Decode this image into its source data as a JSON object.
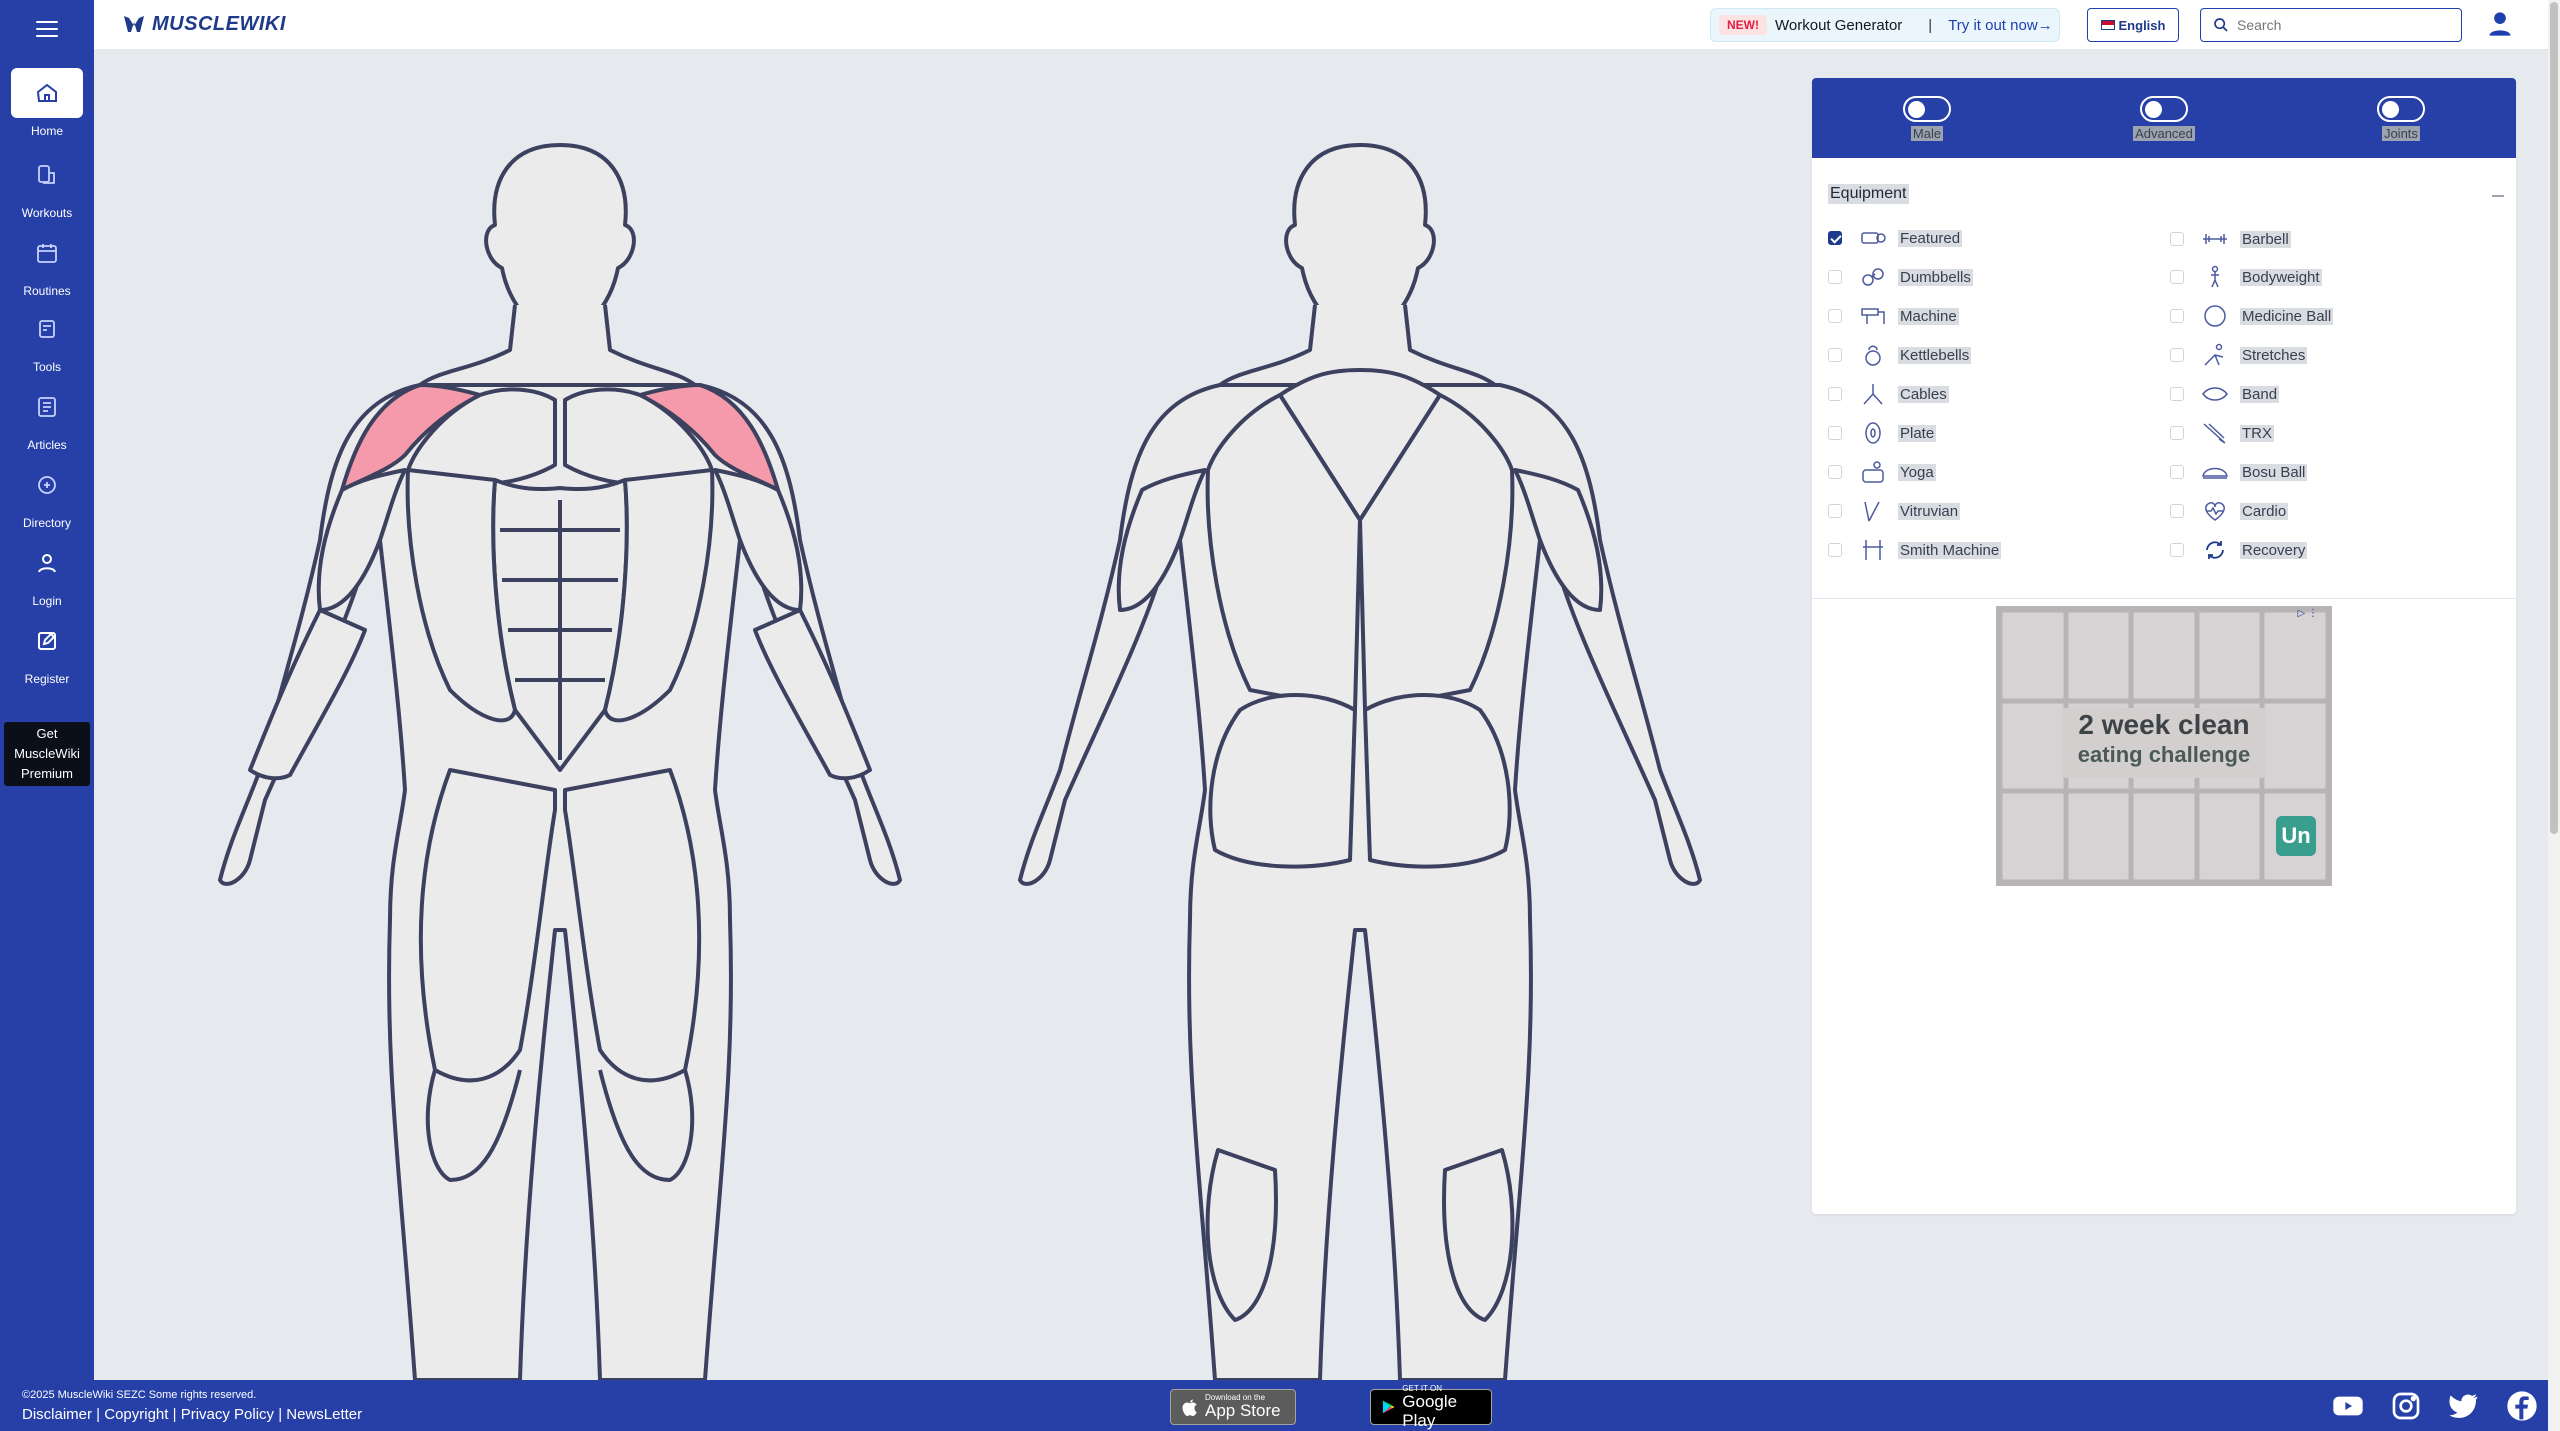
{
  "brand": {
    "logo_text": "MUSCLEWIKI"
  },
  "sidebar": {
    "items": [
      {
        "label": "Home",
        "icon": "home-icon",
        "active": true
      },
      {
        "label": "Workouts",
        "icon": "workouts-icon"
      },
      {
        "label": "Routines",
        "icon": "calendar-icon"
      },
      {
        "label": "Tools",
        "icon": "tools-icon"
      },
      {
        "label": "Articles",
        "icon": "articles-icon"
      },
      {
        "label": "Directory",
        "icon": "directory-icon"
      },
      {
        "label": "Login",
        "icon": "user-icon"
      },
      {
        "label": "Register",
        "icon": "edit-icon"
      }
    ],
    "premium": {
      "line1": "Get",
      "line2": "MuscleWiki",
      "line3": "Premium"
    }
  },
  "header": {
    "promo": {
      "badge": "NEW!",
      "title": "Workout Generator",
      "separator": "|",
      "cta": "Try it out now→"
    },
    "language": "English",
    "search_placeholder": "Search"
  },
  "body_map": {
    "highlight_color": "#f49aaa",
    "highlighted_muscle": "front-deltoids"
  },
  "filters": {
    "toggles": [
      {
        "label": "Male",
        "on": false
      },
      {
        "label": "Advanced",
        "on": false
      },
      {
        "label": "Joints",
        "on": false
      }
    ],
    "equipment_title": "Equipment",
    "equipment": [
      {
        "label": "Featured",
        "checked": true,
        "icon": "featured-icon"
      },
      {
        "label": "Barbell",
        "checked": false,
        "icon": "barbell-icon"
      },
      {
        "label": "Dumbbells",
        "checked": false,
        "icon": "dumbbell-icon"
      },
      {
        "label": "Bodyweight",
        "checked": false,
        "icon": "bodyweight-icon"
      },
      {
        "label": "Machine",
        "checked": false,
        "icon": "machine-icon"
      },
      {
        "label": "Medicine Ball",
        "checked": false,
        "icon": "medicine-ball-icon"
      },
      {
        "label": "Kettlebells",
        "checked": false,
        "icon": "kettlebell-icon"
      },
      {
        "label": "Stretches",
        "checked": false,
        "icon": "stretch-icon"
      },
      {
        "label": "Cables",
        "checked": false,
        "icon": "cable-icon"
      },
      {
        "label": "Band",
        "checked": false,
        "icon": "band-icon"
      },
      {
        "label": "Plate",
        "checked": false,
        "icon": "plate-icon"
      },
      {
        "label": "TRX",
        "checked": false,
        "icon": "trx-icon"
      },
      {
        "label": "Yoga",
        "checked": false,
        "icon": "yoga-icon"
      },
      {
        "label": "Bosu Ball",
        "checked": false,
        "icon": "bosu-ball-icon"
      },
      {
        "label": "Vitruvian",
        "checked": false,
        "icon": "vitruvian-icon"
      },
      {
        "label": "Cardio",
        "checked": false,
        "icon": "cardio-icon"
      },
      {
        "label": "Smith Machine",
        "checked": false,
        "icon": "smith-machine-icon"
      },
      {
        "label": "Recovery",
        "checked": false,
        "icon": "recovery-icon"
      }
    ]
  },
  "ad": {
    "line1": "2 week clean",
    "line2": "eating challenge",
    "logo": "Un"
  },
  "footer": {
    "copyright": "©2025 MuscleWiki SEZC Some rights reserved.",
    "links": [
      "Disclaimer",
      "Copyright",
      "Privacy Policy",
      "NewsLetter"
    ],
    "app_store": {
      "small": "Download on the",
      "big": "App Store"
    },
    "google_play": {
      "small": "GET IT ON",
      "big": "Google Play"
    },
    "socials": [
      "youtube-icon",
      "instagram-icon",
      "twitter-icon",
      "facebook-icon"
    ]
  },
  "colors": {
    "brand_blue": "#2640a8",
    "muscle_fill": "#ebebeb",
    "outline": "#3d4160"
  }
}
